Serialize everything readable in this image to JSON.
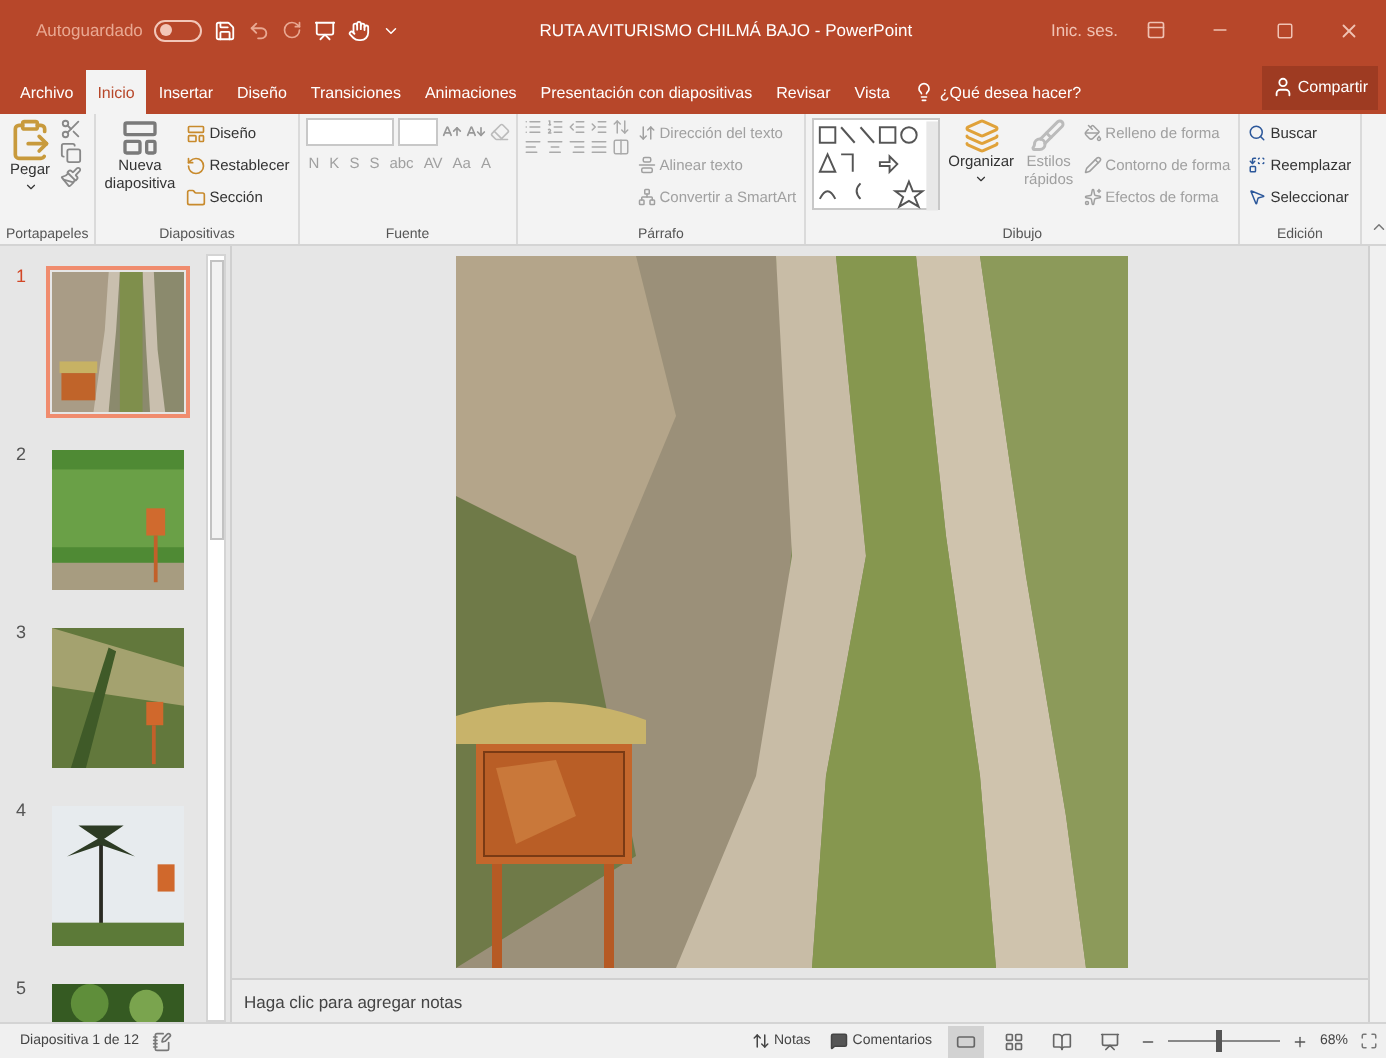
{
  "title_bar": {
    "autosave_label": "Autoguardado",
    "autosave_on": false,
    "title": "RUTA AVITURISMO CHILMÁ BAJO  -  PowerPoint",
    "sign_in": "Inic. ses."
  },
  "tabs": [
    {
      "label": "Archivo",
      "selected": false
    },
    {
      "label": "Inicio",
      "selected": true
    },
    {
      "label": "Insertar",
      "selected": false
    },
    {
      "label": "Diseño",
      "selected": false
    },
    {
      "label": "Transiciones",
      "selected": false
    },
    {
      "label": "Animaciones",
      "selected": false
    },
    {
      "label": "Presentación con diapositivas",
      "selected": false
    },
    {
      "label": "Revisar",
      "selected": false
    },
    {
      "label": "Vista",
      "selected": false
    }
  ],
  "tell_me": "¿Qué desea hacer?",
  "share": "Compartir",
  "ribbon": {
    "clipboard": {
      "label": "Portapapeles",
      "paste": "Pegar"
    },
    "slides_group": {
      "label": "Diapositivas",
      "new_slide": [
        "Nueva",
        "diapositiva"
      ],
      "commands": [
        {
          "label": "Diseño",
          "disabled": false
        },
        {
          "label": "Restablecer",
          "disabled": false
        },
        {
          "label": "Sección",
          "disabled": false
        }
      ]
    },
    "font": {
      "label": "Fuente",
      "format_buttons": [
        "N",
        "K",
        "S",
        "S",
        "abc",
        "AV",
        "Aa",
        "A"
      ],
      "disabled": true
    },
    "paragraph": {
      "label": "Párrafo",
      "commands": [
        {
          "label": "Dirección del texto",
          "disabled": true
        },
        {
          "label": "Alinear texto",
          "disabled": true
        },
        {
          "label": "Convertir a SmartArt",
          "disabled": true
        }
      ]
    },
    "drawing": {
      "label": "Dibujo",
      "arrange": "Organizar",
      "quick_styles": {
        "lines": [
          "Estilos",
          "rápidos"
        ],
        "disabled": true
      },
      "commands": [
        {
          "label": "Relleno de forma",
          "disabled": true
        },
        {
          "label": "Contorno de forma",
          "disabled": true
        },
        {
          "label": "Efectos de forma",
          "disabled": true
        }
      ]
    },
    "editing": {
      "label": "Edición",
      "commands": [
        {
          "label": "Buscar",
          "disabled": false
        },
        {
          "label": "Reemplazar",
          "disabled": false
        },
        {
          "label": "Seleccionar",
          "disabled": false
        }
      ]
    }
  },
  "slides": [
    {
      "number": "1",
      "selected": true
    },
    {
      "number": "2",
      "selected": false
    },
    {
      "number": "3",
      "selected": false
    },
    {
      "number": "4",
      "selected": false
    },
    {
      "number": "5",
      "selected": false
    }
  ],
  "notes_placeholder": "Haga clic para agregar notas",
  "status_bar": {
    "slide_counter": "Diapositiva 1 de 12",
    "notes": "Notas",
    "comments": "Comentarios",
    "views": [
      {
        "selected": true
      },
      {
        "selected": false
      },
      {
        "selected": false
      },
      {
        "selected": false
      }
    ],
    "zoom": {
      "level": 0.45,
      "reading": "68%"
    }
  }
}
